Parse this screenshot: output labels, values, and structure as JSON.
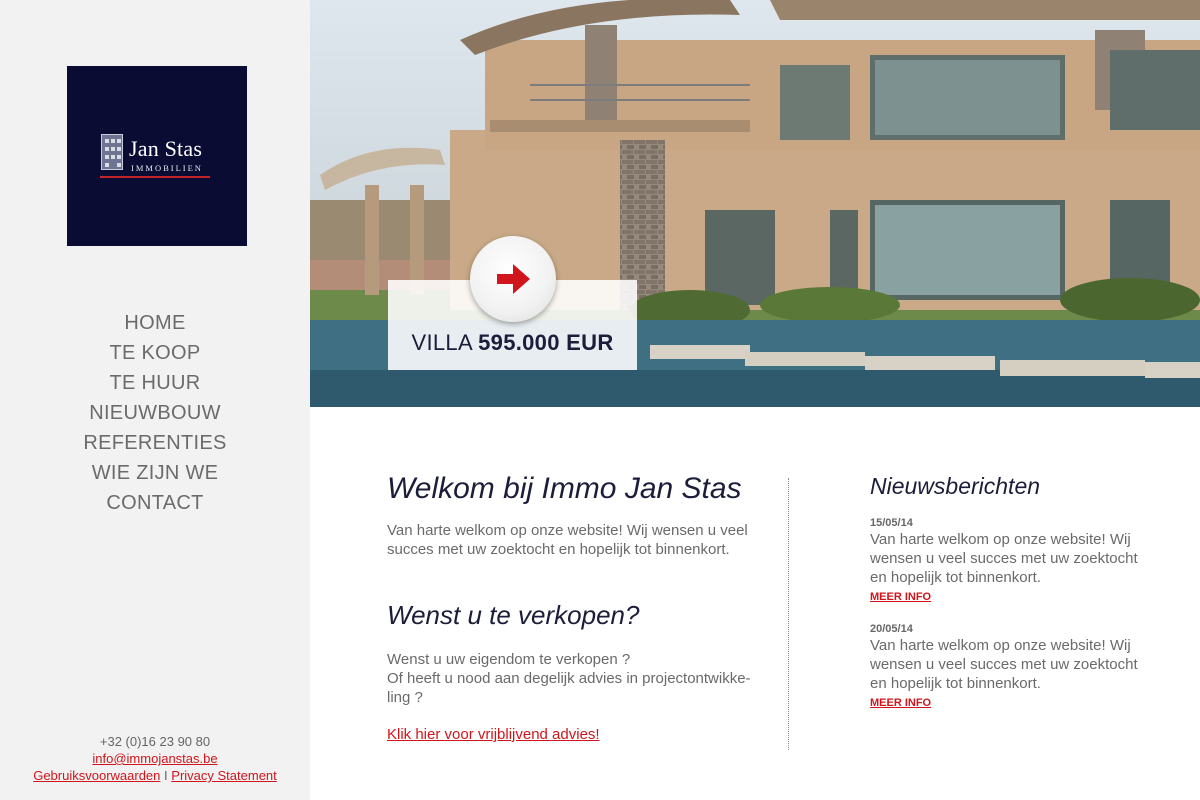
{
  "logo": {
    "name": "Jan Stas",
    "subtitle": "IMMOBILIEN"
  },
  "nav": {
    "items": [
      {
        "label": "HOME"
      },
      {
        "label": "TE KOOP"
      },
      {
        "label": "TE HUUR"
      },
      {
        "label": "NIEUWBOUW"
      },
      {
        "label": "REFERENTIES"
      },
      {
        "label": "WIE ZIJN WE"
      },
      {
        "label": "CONTACT"
      }
    ]
  },
  "contact": {
    "phone": "+32 (0)16 23 90 80",
    "email": "info@immojanstas.be",
    "terms": "Gebruiksvoorwaarden",
    "separator": "I",
    "privacy": "Privacy Statement"
  },
  "hero": {
    "property_type": "VILLA",
    "price": "595.000 EUR",
    "arrow_icon": "arrow-right-icon",
    "accent": "#d0161c"
  },
  "main": {
    "welcome_title": "Welkom bij Immo Jan Stas",
    "welcome_text": "Van harte welkom op onze website! Wij wensen u veel succes met uw zoektocht en hopelijk tot binnenkort.",
    "sell_title": "Wenst u te verkopen?",
    "sell_line1": "Wenst u uw eigendom te verkopen ?",
    "sell_line2": "Of heeft u nood aan degelijk advies in projectontwikke-",
    "sell_line3": "ling ?",
    "advice_link": "Klik hier voor vrijblijvend advies!"
  },
  "news": {
    "title": "Nieuwsberichten",
    "items": [
      {
        "date": "15/05/14",
        "text": "Van harte welkom op onze website! Wij wensen u veel succes met uw zoektocht en hopelijk tot binnenkort.",
        "more": "MEER INFO"
      },
      {
        "date": "20/05/14",
        "text": "Van harte welkom op onze website! Wij wensen u veel succes met uw zoektocht en hopelijk tot binnenkort.",
        "more": "MEER INFO"
      }
    ]
  },
  "colors": {
    "navy": "#0b0c34",
    "sidebar_bg": "#f2f2f2",
    "link_red": "#d0161c",
    "heading": "#1b1d3a"
  }
}
